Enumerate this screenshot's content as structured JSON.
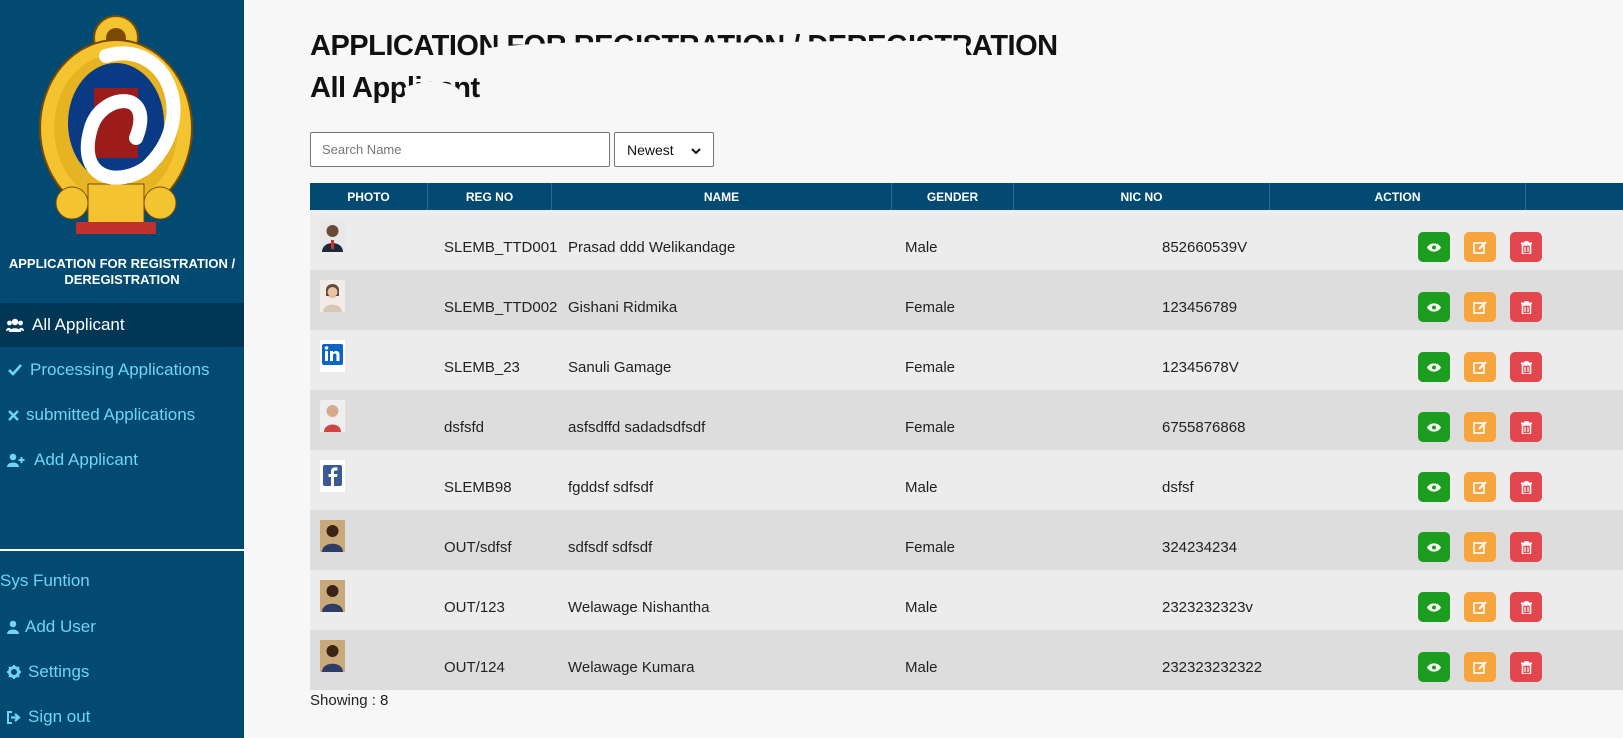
{
  "sidebar": {
    "org_title": "APPLICATION FOR REGISTRATION / DEREGISTRATION",
    "nav": [
      {
        "label": "All Applicant",
        "icon": "users-icon",
        "active": true
      },
      {
        "label": "Processing Applications",
        "icon": "check-icon",
        "active": false
      },
      {
        "label": "submitted Applications",
        "icon": "times-icon",
        "active": false
      },
      {
        "label": "Add Applicant",
        "icon": "user-plus-icon",
        "active": false
      }
    ],
    "sys_title": "Sys Funtion",
    "sys_nav": [
      {
        "label": "Add User",
        "icon": "user-icon"
      },
      {
        "label": "Settings",
        "icon": "gear-icon"
      },
      {
        "label": "Sign out",
        "icon": "sign-out-icon"
      }
    ]
  },
  "main": {
    "title_line1": "APPLICATION FOR REGISTRATION / DEREGISTRATION",
    "title_line2": "All Applicant",
    "search_placeholder": "Search Name",
    "sort_value": "Newest",
    "columns": [
      "PHOTO",
      "REG NO",
      "NAME",
      "GENDER",
      "NIC NO",
      "ACTION"
    ],
    "rows": [
      {
        "reg_no": "SLEMB_TTD001",
        "name": "Prasad ddd Welikandage",
        "gender": "Male",
        "nic": "852660539V",
        "photo": "person-photo"
      },
      {
        "reg_no": "SLEMB_TTD002",
        "name": "Gishani Ridmika",
        "gender": "Female",
        "nic": "123456789",
        "photo": "person-photo"
      },
      {
        "reg_no": "SLEMB_23",
        "name": "Sanuli Gamage",
        "gender": "Female",
        "nic": "12345678V",
        "photo": "linkedin-logo"
      },
      {
        "reg_no": "dsfsfd",
        "name": "asfsdffd sadadsdfsdf",
        "gender": "Female",
        "nic": "6755876868",
        "photo": "person-photo"
      },
      {
        "reg_no": "SLEMB98",
        "name": "fgddsf sdfsdf",
        "gender": "Male",
        "nic": "dsfsf",
        "photo": "facebook-logo"
      },
      {
        "reg_no": "OUT/sdfsf",
        "name": "sdfsdf sdfsdf",
        "gender": "Female",
        "nic": "324234234",
        "photo": "person-photo"
      },
      {
        "reg_no": "OUT/123",
        "name": "Welawage Nishantha",
        "gender": "Male",
        "nic": "2323232323v",
        "photo": "person-photo"
      },
      {
        "reg_no": "OUT/124",
        "name": "Welawage Kumara",
        "gender": "Male",
        "nic": "232323232322",
        "photo": "person-photo"
      }
    ],
    "footer": "Showing : 8"
  },
  "colors": {
    "sidebar_bg": "#024a72",
    "accent_text": "#6fd4f5",
    "view": "#1b9e20",
    "edit": "#f7a43c",
    "delete": "#e4464d"
  }
}
